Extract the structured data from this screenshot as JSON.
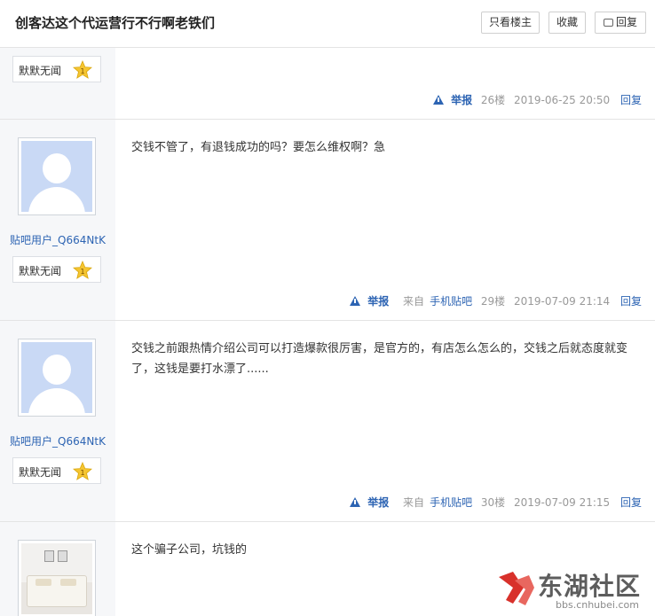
{
  "header": {
    "title": "创客达这个代运营行不行啊老铁们",
    "only_op_label": "只看楼主",
    "favorite_label": "收藏",
    "reply_label": "回复"
  },
  "posts": [
    {
      "badge_text": "默默无闻",
      "level": "1",
      "report_label": "举报",
      "floor": "26楼",
      "time": "2019-06-25 20:50",
      "reply_label": "回复"
    },
    {
      "username": "贴吧用户_Q664NtK",
      "badge_text": "默默无闻",
      "level": "1",
      "content": "交钱不管了，有退钱成功的吗？要怎么维权啊？急",
      "report_label": "举报",
      "source_prefix": "来自",
      "source_link": "手机贴吧",
      "floor": "29楼",
      "time": "2019-07-09 21:14",
      "reply_label": "回复"
    },
    {
      "username": "贴吧用户_Q664NtK",
      "badge_text": "默默无闻",
      "level": "1",
      "content": "交钱之前跟热情介绍公司可以打造爆款很厉害，是官方的，有店怎么怎么的，交钱之后就态度就变了，这钱是要打水漂了......",
      "report_label": "举报",
      "source_prefix": "来自",
      "source_link": "手机贴吧",
      "floor": "30楼",
      "time": "2019-07-09 21:15",
      "reply_label": "回复"
    },
    {
      "content": "这个骗子公司，坑钱的"
    }
  ],
  "watermark": {
    "title": "东湖社区",
    "url": "bbs.cnhubei.com"
  },
  "colors": {
    "link": "#2d64b3",
    "sidebar_bg": "#f6f7f9",
    "star": "#f5c531",
    "logo_red": "#d8312b"
  }
}
